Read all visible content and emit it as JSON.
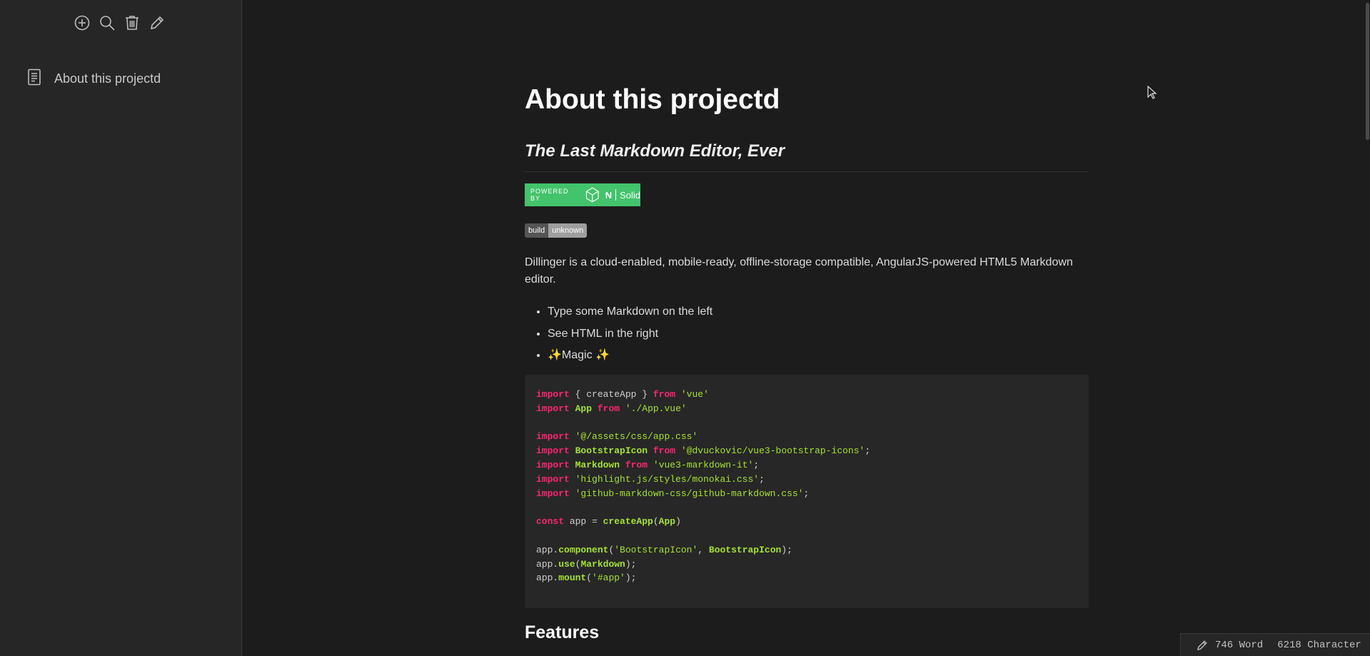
{
  "sidebar": {
    "toolbar": [
      "add-icon",
      "search-icon",
      "trash-icon",
      "pencil-icon"
    ],
    "documents": [
      {
        "label": "About this projectd"
      }
    ]
  },
  "preview": {
    "title": "About this projectd",
    "subtitle": "The Last Markdown Editor, Ever",
    "nsolid_badge": {
      "powered": "POWERED BY",
      "n": "N",
      "solid": "Solid"
    },
    "build_badge": {
      "left": "build",
      "right": "unknown"
    },
    "description": "Dillinger is a cloud-enabled, mobile-ready, offline-storage compatible, AngularJS-powered HTML5 Markdown editor.",
    "bullets": [
      "Type some Markdown on the left",
      "See HTML in the right",
      "✨Magic ✨"
    ],
    "code_lines": [
      [
        [
          "kw",
          "import"
        ],
        [
          "t",
          " { createApp } "
        ],
        [
          "kw",
          "from"
        ],
        [
          "t",
          " "
        ],
        [
          "str",
          "'vue'"
        ]
      ],
      [
        [
          "kw",
          "import"
        ],
        [
          "t",
          " "
        ],
        [
          "cls",
          "App"
        ],
        [
          "t",
          " "
        ],
        [
          "kw",
          "from"
        ],
        [
          "t",
          " "
        ],
        [
          "str",
          "'./App.vue'"
        ]
      ],
      [],
      [
        [
          "kw",
          "import"
        ],
        [
          "t",
          " "
        ],
        [
          "str",
          "'@/assets/css/app.css'"
        ]
      ],
      [
        [
          "kw",
          "import"
        ],
        [
          "t",
          " "
        ],
        [
          "cls",
          "BootstrapIcon"
        ],
        [
          "t",
          " "
        ],
        [
          "kw",
          "from"
        ],
        [
          "t",
          " "
        ],
        [
          "str",
          "'@dvuckovic/vue3-bootstrap-icons'"
        ],
        [
          "t",
          ";"
        ]
      ],
      [
        [
          "kw",
          "import"
        ],
        [
          "t",
          " "
        ],
        [
          "cls",
          "Markdown"
        ],
        [
          "t",
          " "
        ],
        [
          "kw",
          "from"
        ],
        [
          "t",
          " "
        ],
        [
          "str",
          "'vue3-markdown-it'"
        ],
        [
          "t",
          ";"
        ]
      ],
      [
        [
          "kw",
          "import"
        ],
        [
          "t",
          " "
        ],
        [
          "str",
          "'highlight.js/styles/monokai.css'"
        ],
        [
          "t",
          ";"
        ]
      ],
      [
        [
          "kw",
          "import"
        ],
        [
          "t",
          " "
        ],
        [
          "str",
          "'github-markdown-css/github-markdown.css'"
        ],
        [
          "t",
          ";"
        ]
      ],
      [],
      [
        [
          "kw",
          "const"
        ],
        [
          "t",
          " app = "
        ],
        [
          "fn",
          "createApp"
        ],
        [
          "t",
          "("
        ],
        [
          "cls",
          "App"
        ],
        [
          "t",
          ")"
        ]
      ],
      [],
      [
        [
          "t",
          "app."
        ],
        [
          "fn",
          "component"
        ],
        [
          "t",
          "("
        ],
        [
          "str",
          "'BootstrapIcon'"
        ],
        [
          "t",
          ", "
        ],
        [
          "cls",
          "BootstrapIcon"
        ],
        [
          "t",
          ");"
        ]
      ],
      [
        [
          "t",
          "app."
        ],
        [
          "fn",
          "use"
        ],
        [
          "t",
          "("
        ],
        [
          "cls",
          "Markdown"
        ],
        [
          "t",
          ");"
        ]
      ],
      [
        [
          "t",
          "app."
        ],
        [
          "fn",
          "mount"
        ],
        [
          "t",
          "("
        ],
        [
          "str",
          "'#app'"
        ],
        [
          "t",
          ");"
        ]
      ]
    ],
    "features_heading": "Features"
  },
  "status": {
    "words": "746 Word",
    "characters": "6218 Character"
  }
}
